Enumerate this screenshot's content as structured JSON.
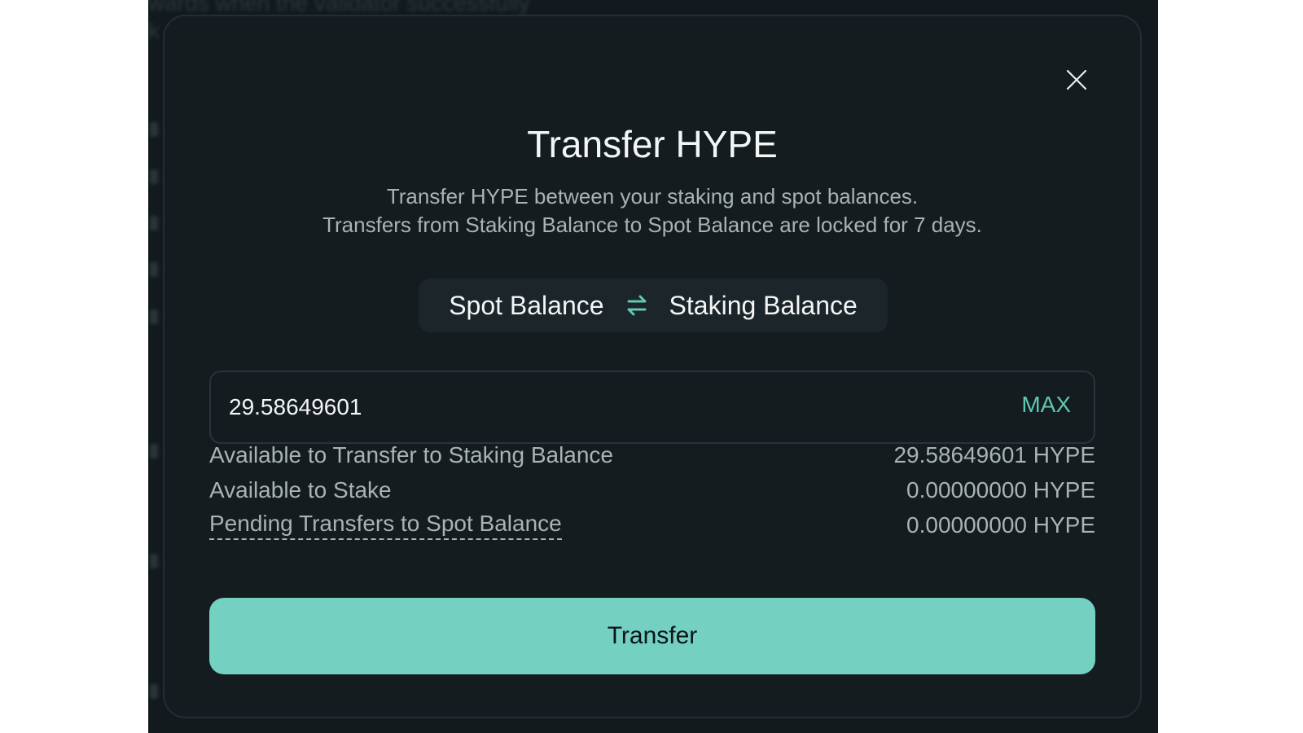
{
  "background": {
    "ghost_text_lines": [
      "wards when the validator successfully",
      "k"
    ]
  },
  "modal": {
    "title": "Transfer HYPE",
    "subtitle_line1": "Transfer HYPE between your staking and spot balances.",
    "subtitle_line2": "Transfers from Staking Balance to Spot Balance are locked for 7 days.",
    "from_balance": "Spot Balance",
    "to_balance": "Staking Balance",
    "amount_value": "29.58649601",
    "max_label": "MAX",
    "info_rows": [
      {
        "label": "Available to Transfer to Staking Balance",
        "value": "29.58649601 HYPE"
      },
      {
        "label": "Available to Stake",
        "value": "0.00000000 HYPE"
      },
      {
        "label": "Pending Transfers to Spot Balance",
        "value": "0.00000000 HYPE"
      }
    ],
    "transfer_label": "Transfer"
  },
  "icons": {
    "close": "close-icon",
    "swap": "swap-arrows-icon"
  },
  "colors": {
    "accent": "#74d0c1",
    "accent_text": "#5fc7b2",
    "modal_bg": "#141c20",
    "backdrop_bg": "#121a1e"
  }
}
